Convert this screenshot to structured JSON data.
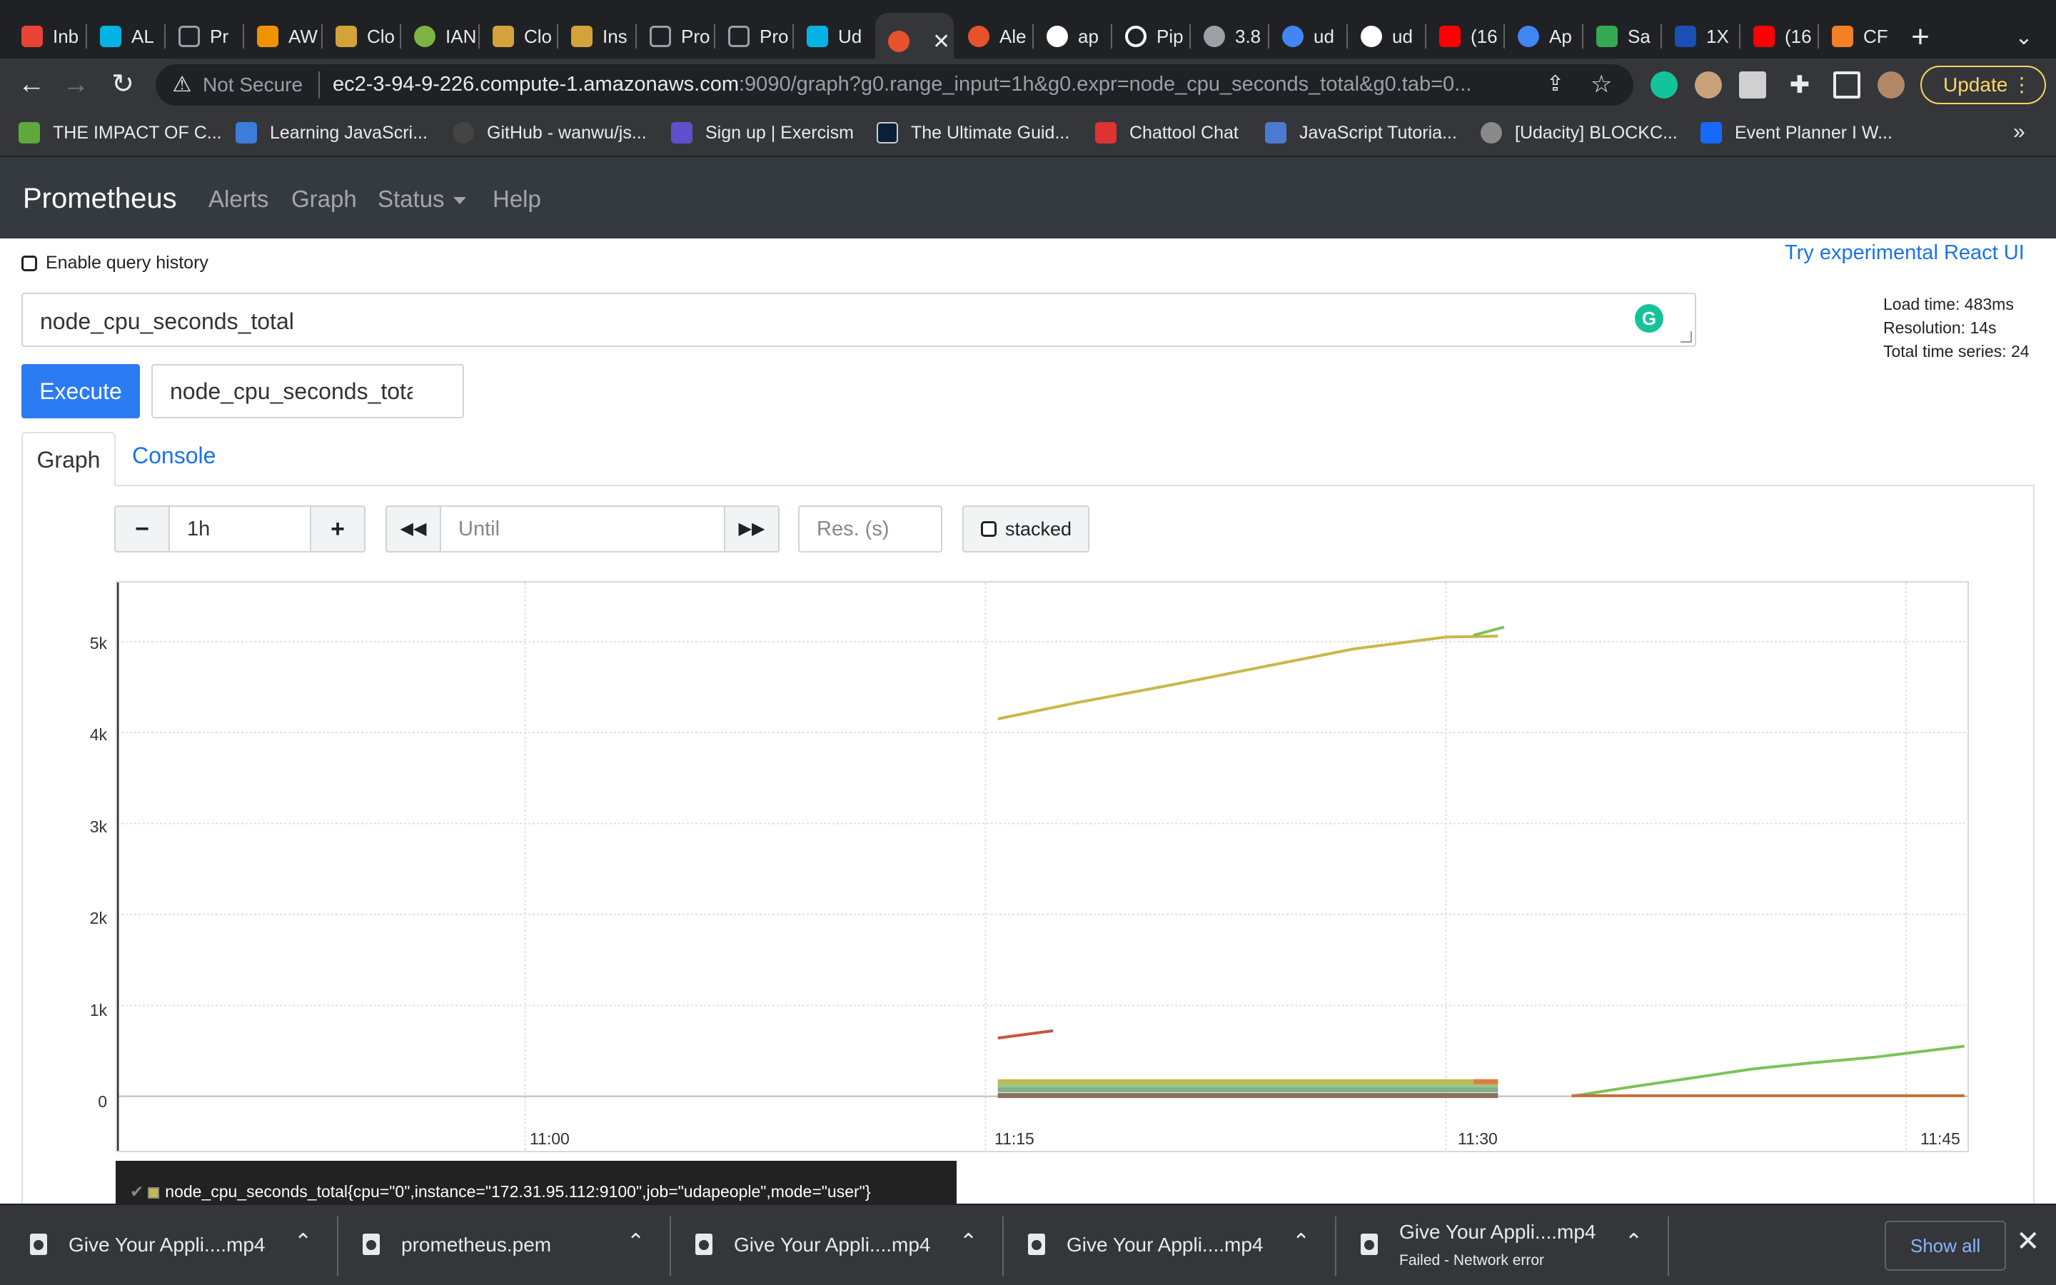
{
  "browser": {
    "tabs": [
      {
        "title": "Inb",
        "icon": "gmail-icon",
        "color": "#ea4335"
      },
      {
        "title": "AL",
        "icon": "udacity-icon",
        "color": "#02b3e4"
      },
      {
        "title": "Pr",
        "icon": "terminal-icon",
        "color": "#9aa0a6"
      },
      {
        "title": "AW",
        "icon": "aws-cube-icon",
        "color": "#f29100"
      },
      {
        "title": "Clo",
        "icon": "aws-box-icon",
        "color": "#d4a23a"
      },
      {
        "title": "IAN",
        "icon": "key-icon",
        "color": "#7cb342"
      },
      {
        "title": "Clo",
        "icon": "aws-box-icon",
        "color": "#d4a23a"
      },
      {
        "title": "Ins",
        "icon": "aws-box-icon",
        "color": "#d4a23a"
      },
      {
        "title": "Pro",
        "icon": "terminal-icon",
        "color": "#9aa0a6"
      },
      {
        "title": "Pro",
        "icon": "terminal-icon",
        "color": "#9aa0a6"
      },
      {
        "title": "Ud",
        "icon": "udacity-icon",
        "color": "#02b3e4"
      },
      {
        "title": "",
        "icon": "prometheus-icon",
        "color": "#e6522c",
        "active": true
      },
      {
        "title": "Ale",
        "icon": "prometheus-icon",
        "color": "#e6522c"
      },
      {
        "title": "ap",
        "icon": "github-icon",
        "color": "#ffffff"
      },
      {
        "title": "Pip",
        "icon": "circleci-icon",
        "color": "#ffffff"
      },
      {
        "title": "3.8",
        "icon": "globe-icon",
        "color": "#9aa0a6"
      },
      {
        "title": "ud",
        "icon": "google-icon",
        "color": "#4285f4"
      },
      {
        "title": "ud",
        "icon": "github-icon",
        "color": "#ffffff"
      },
      {
        "title": "(16",
        "icon": "youtube-icon",
        "color": "#ff0000"
      },
      {
        "title": "Ap",
        "icon": "google-icon",
        "color": "#4285f4"
      },
      {
        "title": "Sa",
        "icon": "download-arrow-icon",
        "color": "#34a853"
      },
      {
        "title": "1X",
        "icon": "cs-icon",
        "color": "#1a4fb5"
      },
      {
        "title": "(16",
        "icon": "youtube-icon",
        "color": "#ff0000"
      },
      {
        "title": "CF",
        "icon": "stackoverflow-icon",
        "color": "#f48024"
      }
    ],
    "new_tab_label": "+",
    "url_warning": "Not Secure",
    "url_host": "ec2-3-94-9-226.compute-1.amazonaws.com",
    "url_path": ":9090/graph?g0.range_input=1h&g0.expr=node_cpu_seconds_total&g0.tab=0...",
    "update_label": "Update",
    "bookmarks": [
      {
        "label": "THE IMPACT OF C...",
        "color": "#5fa83a"
      },
      {
        "label": "Learning JavaScri...",
        "color": "#3b7dd8"
      },
      {
        "label": "GitHub - wanwu/js...",
        "color": "#444444"
      },
      {
        "label": "Sign up | Exercism",
        "color": "#604fcd"
      },
      {
        "label": "The Ultimate Guid...",
        "color": "#0b1f3a"
      },
      {
        "label": "Chattool Chat",
        "color": "#dd3333"
      },
      {
        "label": "JavaScript Tutoria...",
        "color": "#4a7bd0"
      },
      {
        "label": "[Udacity] BLOCKC...",
        "color": "#8a8a8a"
      },
      {
        "label": "Event Planner I W...",
        "color": "#1769ff"
      }
    ],
    "bookmarks_more": "»"
  },
  "prometheus": {
    "brand": "Prometheus",
    "nav": {
      "alerts": "Alerts",
      "graph": "Graph",
      "status": "Status",
      "help": "Help"
    },
    "enable_history": "Enable query history",
    "react_link": "Try experimental React UI",
    "expression": "node_cpu_seconds_total",
    "stats": {
      "load_time": "Load time: 483ms",
      "resolution": "Resolution: 14s",
      "total_series": "Total time series: 24"
    },
    "execute_label": "Execute",
    "metric_select_value": "node_cpu_seconds_total",
    "tabs": {
      "graph": "Graph",
      "console": "Console"
    },
    "controls": {
      "minus": "−",
      "range": "1h",
      "plus": "+",
      "back": "◀◀",
      "until_placeholder": "Until",
      "forward": "▶▶",
      "res_placeholder": "Res. (s)",
      "stacked": "stacked"
    },
    "legend_label": "node_cpu_seconds_total{cpu=\"0\",instance=\"172.31.95.112:9100\",job=\"udapeople\",mode=\"user\"}"
  },
  "chart_data": {
    "type": "line",
    "title": "",
    "xlabel": "",
    "ylabel": "",
    "x_ticks": [
      "11:00",
      "11:15",
      "11:30",
      "11:45"
    ],
    "y_ticks": [
      "0",
      "1k",
      "2k",
      "3k",
      "4k",
      "5k"
    ],
    "ylim": [
      -600,
      5650
    ],
    "xlim_minutes": [
      -13.3,
      47.0
    ],
    "grid": true,
    "legend": "bottom",
    "series": [
      {
        "color": "#c8b84a",
        "x": [
          15.4,
          18.0,
          21.0,
          24.0,
          27.0,
          30.0,
          31.7
        ],
        "y": [
          4150,
          4330,
          4520,
          4720,
          4920,
          5050,
          5060
        ]
      },
      {
        "color": "#7cc35a",
        "x": [
          30.9,
          31.9
        ],
        "y": [
          5070,
          5160
        ]
      },
      {
        "color": "#c8553d",
        "x": [
          15.4,
          17.2
        ],
        "y": [
          640,
          720
        ]
      },
      {
        "color": "#c8b84a",
        "x": [
          15.4,
          31.7
        ],
        "y": [
          160,
          160
        ]
      },
      {
        "color": "#9ec77e",
        "x": [
          15.4,
          31.7
        ],
        "y": [
          120,
          120
        ]
      },
      {
        "color": "#7fb08b",
        "x": [
          15.4,
          31.7
        ],
        "y": [
          70,
          70
        ]
      },
      {
        "color": "#8b6f5c",
        "x": [
          15.4,
          31.7
        ],
        "y": [
          8,
          8
        ]
      },
      {
        "color": "#e07c45",
        "x": [
          30.9,
          31.7
        ],
        "y": [
          160,
          160
        ]
      },
      {
        "color": "#7cc35a",
        "x": [
          34.1,
          36.0,
          38.0,
          40.0,
          42.0,
          44.0,
          46.9
        ],
        "y": [
          0,
          100,
          200,
          300,
          370,
          430,
          550
        ]
      },
      {
        "color": "#c86e3a",
        "x": [
          34.1,
          46.9
        ],
        "y": [
          5,
          5
        ]
      }
    ]
  },
  "downloads": [
    {
      "name": "Give Your Appli....mp4",
      "status": ""
    },
    {
      "name": "prometheus.pem",
      "status": ""
    },
    {
      "name": "Give Your Appli....mp4",
      "status": ""
    },
    {
      "name": "Give Your Appli....mp4",
      "status": ""
    },
    {
      "name": "Give Your Appli....mp4",
      "status": "Failed - Network error"
    }
  ],
  "downloads_show_all": "Show all"
}
